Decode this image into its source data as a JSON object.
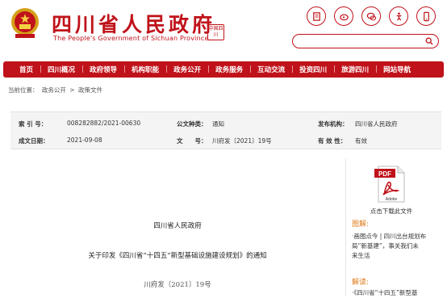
{
  "header": {
    "site_title": "四川省人民政府",
    "site_subtitle": "The People's Government of Sichuan Province",
    "seal_text": "中国四川",
    "icons": [
      "accessibility-info-icon",
      "weibo-icon",
      "wechat-icon",
      "elder-mode-icon",
      "mobile-icon"
    ],
    "search_placeholder": ""
  },
  "nav": {
    "items": [
      "首页",
      "四川概况",
      "政府领导",
      "机构职能",
      "政务公开",
      "政务服务",
      "互动交流",
      "投资四川",
      "旅游四川",
      "网站导航"
    ]
  },
  "breadcrumb": {
    "prefix": "当前位置：",
    "items": [
      "政务公开",
      "政策文件"
    ],
    "separator": ">"
  },
  "info": {
    "index_label": "索 引 号：",
    "index_value": "008282882/2021-00630",
    "category_label": "公文种类：",
    "category_value": "通知",
    "publisher_label": "发布机构：",
    "publisher_value": "四川省人民政府",
    "date_label": "成文日期：",
    "date_value": "2021-09-08",
    "docno_label": "文　　号：",
    "docno_value": "川府发〔2021〕19号",
    "validity_label": "有 效 性：",
    "validity_value": "有效"
  },
  "document": {
    "issuer": "四川省人民政府",
    "title": "关于印发《四川省“十四五”新型基础设施建设规划》的通知",
    "number": "川府发〔2021〕19号"
  },
  "sidebar": {
    "pdf_badge": "PDF",
    "pdf_brand": "Adobe",
    "download_label": "点击下载此文件",
    "graphic_heading": "图解:",
    "graphic_item_line1": "·画图点今 | 四川出台规划布",
    "graphic_item_line2": "局“新基建”，事关我们未",
    "graphic_item_line3": "来生活",
    "interp_heading": "解读:",
    "interp_item": "·《四川省“十四五”新型基"
  },
  "colors": {
    "brand_red": "#c0121a",
    "accent_orange": "#e07a1a"
  }
}
